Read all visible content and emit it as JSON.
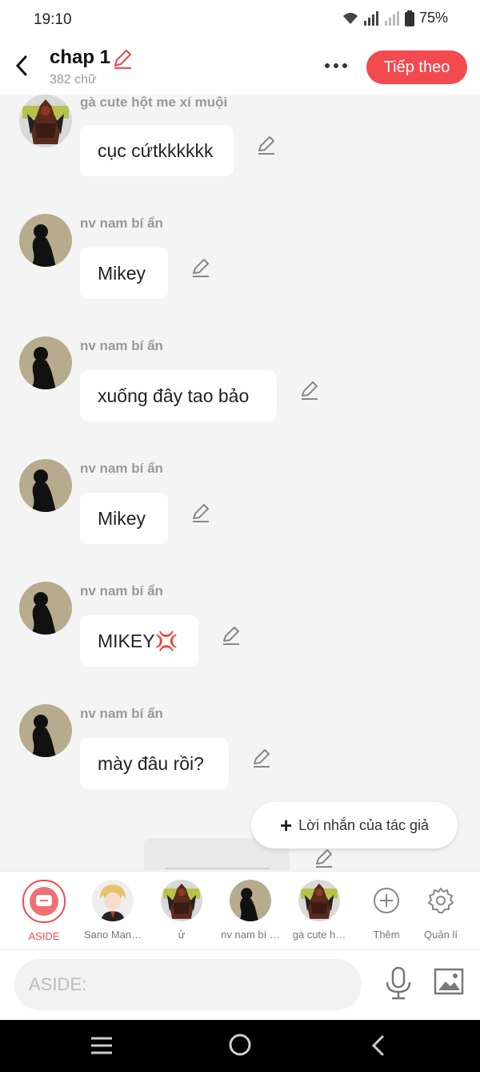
{
  "status_bar": {
    "time": "19:10",
    "battery": "75%"
  },
  "header": {
    "title": "chap 1",
    "subtitle": "382 chữ",
    "next_label": "Tiếp theo"
  },
  "messages": [
    {
      "sender": "gà cute hột me xí muội",
      "text": "cục cứtkkkkkk",
      "avatar": "warrior"
    },
    {
      "sender": "nv nam bí ẩn",
      "text": "Mikey",
      "avatar": "silhouette"
    },
    {
      "sender": "nv nam bí ẩn",
      "text": "xuống đây tao bảo",
      "avatar": "silhouette"
    },
    {
      "sender": "nv nam bí ẩn",
      "text": "Mikey",
      "avatar": "silhouette"
    },
    {
      "sender": "nv nam bí ẩn",
      "text": "MIKEY💢",
      "avatar": "silhouette"
    },
    {
      "sender": "nv nam bí ẩn",
      "text": "mày đâu rồi?",
      "avatar": "silhouette"
    }
  ],
  "author_note_label": "Lời nhắn của tác giả",
  "characters": [
    {
      "name": "ASIDE",
      "type": "aside"
    },
    {
      "name": "Sano Man…",
      "type": "anime"
    },
    {
      "name": "ử",
      "type": "warrior"
    },
    {
      "name": "nv nam bí …",
      "type": "silhouette"
    },
    {
      "name": "gà cute h…",
      "type": "warrior"
    }
  ],
  "actions": {
    "more_label": "Thêm",
    "manage_label": "Quản lí"
  },
  "input": {
    "placeholder": "ASIDE:"
  },
  "colors": {
    "accent": "#f24a4f",
    "background": "#f4f4f4",
    "bubble": "#ffffff"
  }
}
